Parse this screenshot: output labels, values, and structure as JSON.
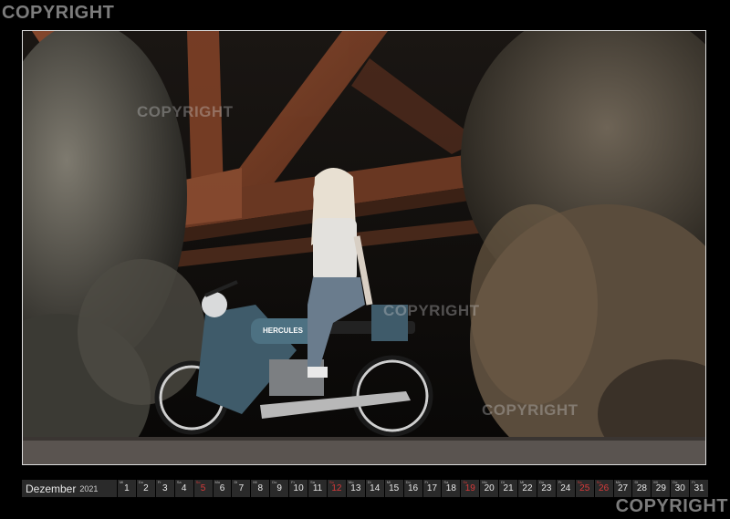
{
  "watermarks": {
    "top_left": "COPYRIGHT",
    "bottom_right": "COPYRIGHT",
    "inner": [
      "COPYRIGHT",
      "COPYRIGHT",
      "COPYRIGHT"
    ]
  },
  "photo": {
    "bike_badge": "HERCULES"
  },
  "calendar": {
    "month": "Dezember",
    "year": "2021",
    "days": [
      {
        "wd": "Mi",
        "num": "1",
        "red": false
      },
      {
        "wd": "Do",
        "num": "2",
        "red": false
      },
      {
        "wd": "Fr",
        "num": "3",
        "red": false
      },
      {
        "wd": "Sa",
        "num": "4",
        "red": false
      },
      {
        "wd": "So",
        "num": "5",
        "red": true
      },
      {
        "wd": "Mo",
        "num": "6",
        "red": false
      },
      {
        "wd": "Di",
        "num": "7",
        "red": false
      },
      {
        "wd": "Mi",
        "num": "8",
        "red": false
      },
      {
        "wd": "Do",
        "num": "9",
        "red": false
      },
      {
        "wd": "Fr",
        "num": "10",
        "red": false
      },
      {
        "wd": "Sa",
        "num": "11",
        "red": false
      },
      {
        "wd": "So",
        "num": "12",
        "red": true
      },
      {
        "wd": "Mo",
        "num": "13",
        "red": false
      },
      {
        "wd": "Di",
        "num": "14",
        "red": false
      },
      {
        "wd": "Mi",
        "num": "15",
        "red": false
      },
      {
        "wd": "Do",
        "num": "16",
        "red": false
      },
      {
        "wd": "Fr",
        "num": "17",
        "red": false
      },
      {
        "wd": "Sa",
        "num": "18",
        "red": false
      },
      {
        "wd": "So",
        "num": "19",
        "red": true
      },
      {
        "wd": "Mo",
        "num": "20",
        "red": false
      },
      {
        "wd": "Di",
        "num": "21",
        "red": false
      },
      {
        "wd": "Mi",
        "num": "22",
        "red": false
      },
      {
        "wd": "Do",
        "num": "23",
        "red": false
      },
      {
        "wd": "Fr",
        "num": "24",
        "red": false
      },
      {
        "wd": "Sa",
        "num": "25",
        "red": true
      },
      {
        "wd": "So",
        "num": "26",
        "red": true
      },
      {
        "wd": "Mo",
        "num": "27",
        "red": false
      },
      {
        "wd": "Di",
        "num": "28",
        "red": false
      },
      {
        "wd": "Mi",
        "num": "29",
        "red": false
      },
      {
        "wd": "Do",
        "num": "30",
        "red": false
      },
      {
        "wd": "Fr",
        "num": "31",
        "red": false
      }
    ]
  }
}
